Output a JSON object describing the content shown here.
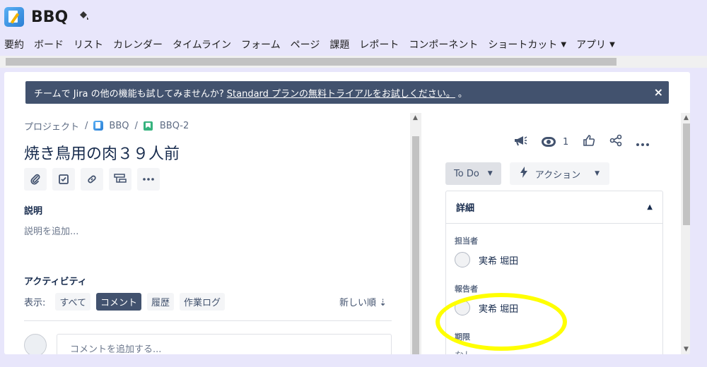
{
  "project": {
    "name": "BBQ"
  },
  "nav": {
    "tabs": [
      "要約",
      "ボード",
      "リスト",
      "カレンダー",
      "タイムライン",
      "フォーム",
      "ページ",
      "課題",
      "レポート",
      "コンポーネント",
      "ショートカット",
      "アプリ"
    ]
  },
  "banner": {
    "text": "チームで Jira の他の機能も試してみませんか?",
    "link": "Standard プランの無料トライアルをお試しください。",
    "suffix": "。",
    "close": "×"
  },
  "breadcrumb": {
    "root": "プロジェクト",
    "project": "BBQ",
    "issue": "BBQ-2"
  },
  "issue": {
    "title": "焼き鳥用の肉３９人前",
    "description_label": "説明",
    "description_placeholder": "説明を追加..."
  },
  "activity": {
    "heading": "アクティビティ",
    "show_label": "表示:",
    "filters": [
      "すべて",
      "コメント",
      "履歴",
      "作業ログ"
    ],
    "active_filter": "コメント",
    "sort": "新しい順",
    "comment_placeholder": "コメントを追加する..."
  },
  "watchers": {
    "count": "1"
  },
  "status": {
    "label": "To Do",
    "actions_label": "アクション"
  },
  "details": {
    "heading": "詳細",
    "assignee_label": "担当者",
    "assignee": "実希 堀田",
    "reporter_label": "報告者",
    "reporter": "実希 堀田",
    "due_label": "期限",
    "due_value": "なし"
  },
  "annotation": {
    "color": "#ffff00"
  }
}
